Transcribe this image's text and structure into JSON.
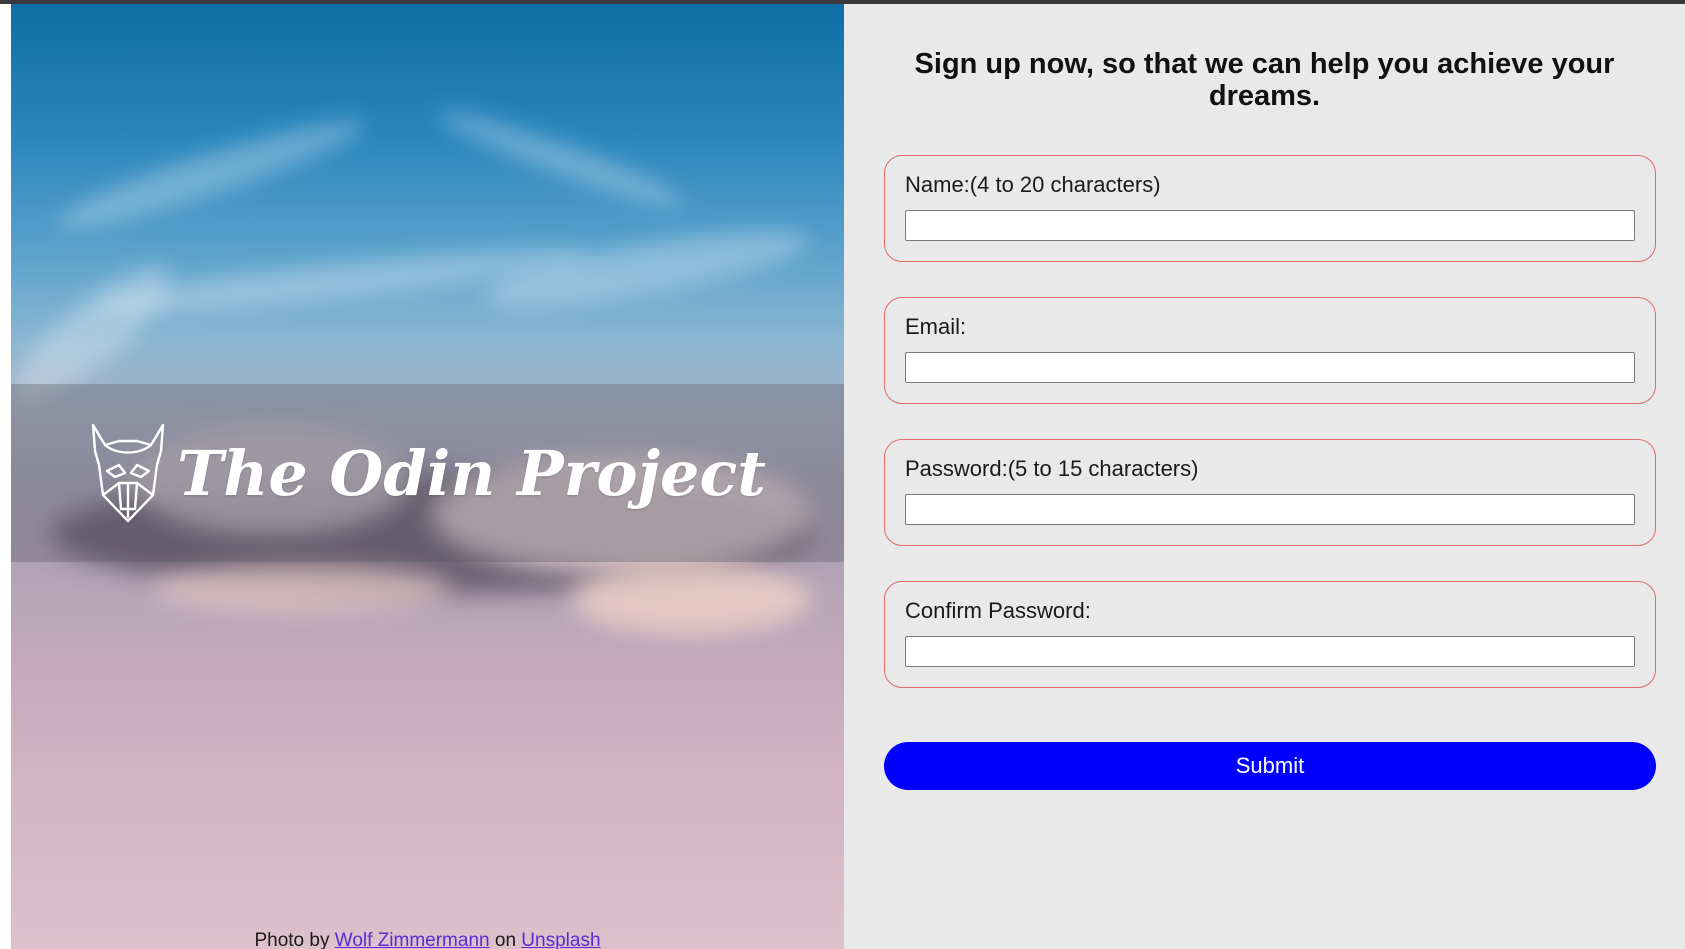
{
  "hero": {
    "brand_name": "The Odin Project",
    "logo_icon": "odin-viking-helmet-icon",
    "credit": {
      "prefix": "Photo by ",
      "author": "Wolf Zimmermann",
      "middle": " on ",
      "site": "Unsplash"
    }
  },
  "form": {
    "heading": "Sign up now, so that we can help you achieve your dreams.",
    "fields": [
      {
        "label": "Name:(4 to 20 characters)",
        "value": ""
      },
      {
        "label": "Email:",
        "value": ""
      },
      {
        "label": "Password:(5 to 15 characters)",
        "value": ""
      },
      {
        "label": "Confirm Password:",
        "value": ""
      }
    ],
    "submit_label": "Submit"
  },
  "colors": {
    "panel_bg": "#e9e9e9",
    "field_border": "#e06a6a",
    "submit_bg": "#0000ff",
    "link": "#5b2bd6"
  }
}
